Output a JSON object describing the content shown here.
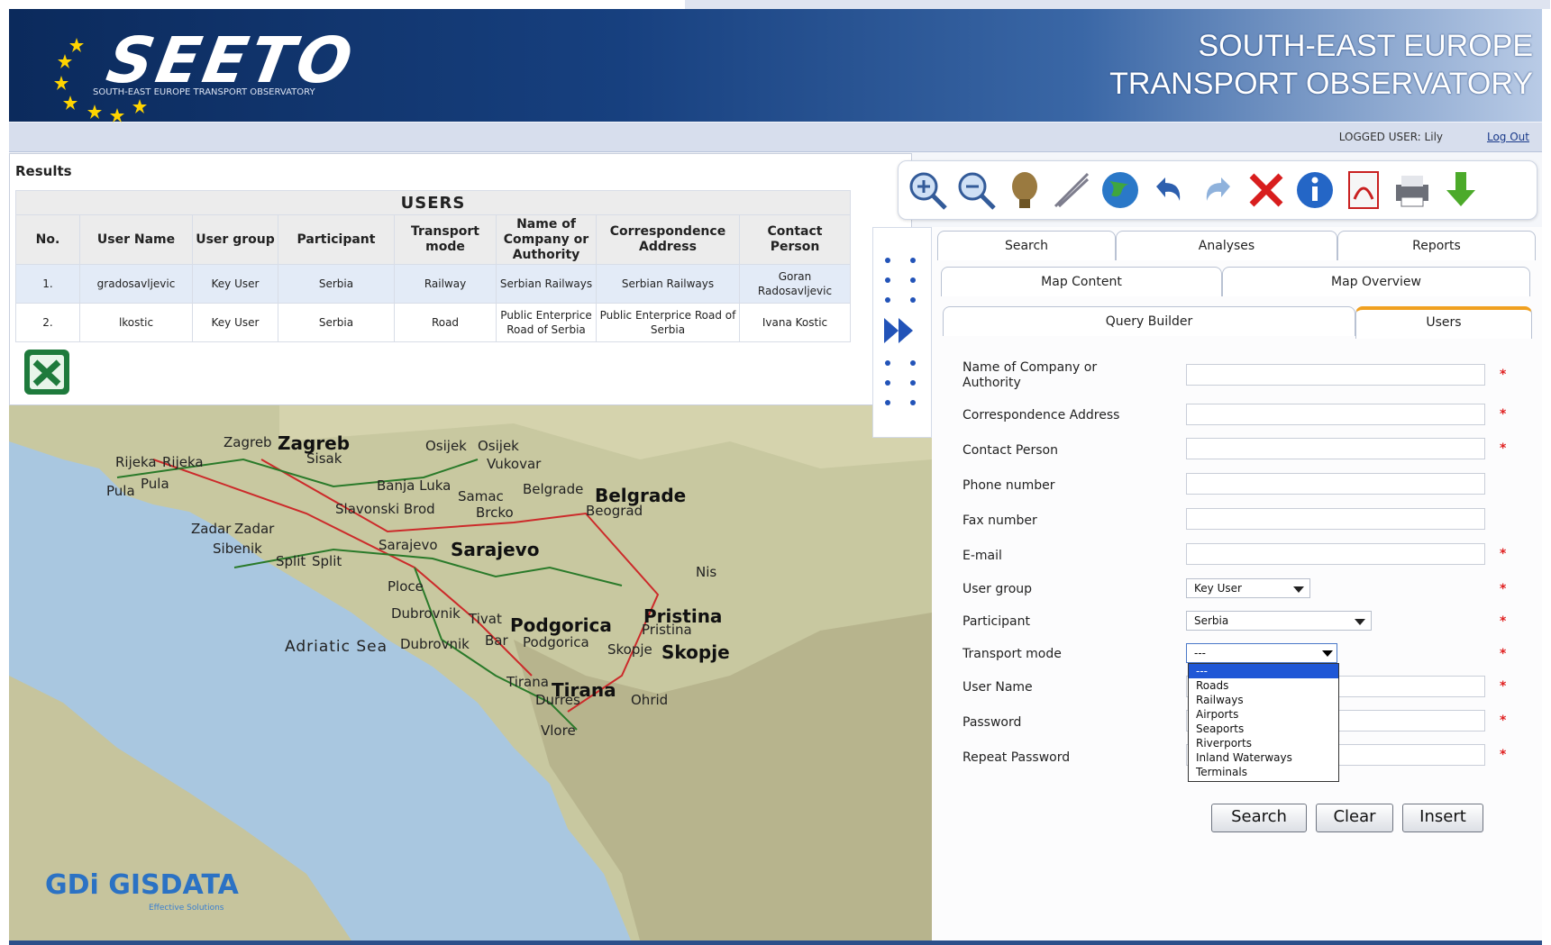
{
  "header": {
    "logo": "SEETO",
    "logo_sub": "SOUTH-EAST EUROPE TRANSPORT OBSERVATORY",
    "title_line1": "SOUTH-EAST EUROPE",
    "title_line2": "TRANSPORT OBSERVATORY"
  },
  "userbar": {
    "logged_user": "LOGGED USER: Lily",
    "logout": "Log Out"
  },
  "results": {
    "title": "Results",
    "table_caption": "USERS",
    "columns": [
      "No.",
      "User Name",
      "User group",
      "Participant",
      "Transport mode",
      "Name of Company or Authority",
      "Correspondence Address",
      "Contact Person"
    ],
    "rows": [
      [
        "1.",
        "gradosavljevic",
        "Key User",
        "Serbia",
        "Railway",
        "Serbian Railways",
        "Serbian Railways",
        "Goran Radosavljevic"
      ],
      [
        "2.",
        "lkostic",
        "Key User",
        "Serbia",
        "Road",
        "Public Enterprice Road of Serbia",
        "Public Enterprice Road of Serbia",
        "Ivana Kostic"
      ]
    ]
  },
  "toolbar": {
    "icons": [
      "zoom-in-icon",
      "zoom-out-icon",
      "pan-icon",
      "measure-icon",
      "globe-icon",
      "undo-icon",
      "redo-icon",
      "clear-icon",
      "info-icon",
      "pdf-icon",
      "print-icon",
      "download-icon"
    ]
  },
  "tabs": {
    "search": "Search",
    "analyses": "Analyses",
    "reports": "Reports",
    "map_content": "Map Content",
    "map_overview": "Map Overview",
    "query_builder": "Query Builder",
    "users": "Users"
  },
  "form": {
    "company_label": "Name of Company or Authority",
    "address_label": "Correspondence Address",
    "contact_label": "Contact Person",
    "phone_label": "Phone number",
    "fax_label": "Fax number",
    "email_label": "E-mail",
    "group_label": "User group",
    "participant_label": "Participant",
    "mode_label": "Transport mode",
    "username_label": "User Name",
    "password_label": "Password",
    "repeat_label": "Repeat Password",
    "required_mark": "*",
    "group_value": "Key User",
    "participant_value": "Serbia",
    "mode_value": "---",
    "mode_options": [
      "---",
      "Roads",
      "Railways",
      "Airports",
      "Seaports",
      "Riverports",
      "Inland Waterways",
      "Terminals"
    ],
    "btn_search": "Search",
    "btn_clear": "Clear",
    "btn_insert": "Insert"
  },
  "map": {
    "sea": "Adriatic Sea",
    "cities_big": [
      "Zagreb",
      "Belgrade",
      "Sarajevo",
      "Podgorica",
      "Pristina",
      "Skopje",
      "Tirana"
    ],
    "cities": [
      "Zagreb",
      "Sisak",
      "Rijeka",
      "Rijeka",
      "Pula",
      "Pula",
      "Osijek",
      "Osijek",
      "Vukovar",
      "Banja Luka",
      "Samac",
      "Brcko",
      "Slavonski Brod",
      "Belgrade",
      "Beograd",
      "Zadar",
      "Zadar",
      "Sibenik",
      "Split",
      "Split",
      "Sarajevo",
      "Ploce",
      "Nis",
      "Dubrovnik",
      "Dubrovnik",
      "Tivat",
      "Bar",
      "Podgorica",
      "Pristina",
      "Skopje",
      "Tirana",
      "Durres",
      "Ohrid",
      "Vlore"
    ],
    "provider": "GISDATA",
    "provider_prefix": "GDi",
    "provider_sub": "Effective Solutions"
  }
}
